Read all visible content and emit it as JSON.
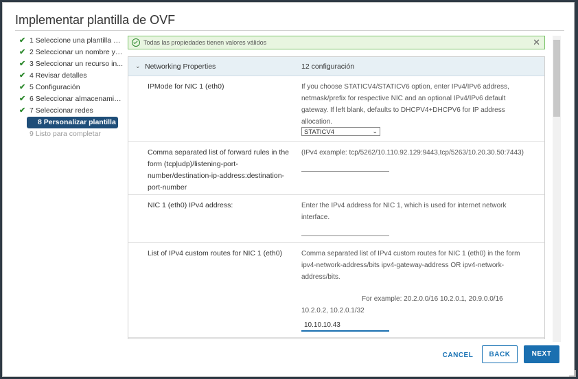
{
  "dialog": {
    "title": "Implementar plantilla de OVF"
  },
  "steps": [
    {
      "label": "1 Seleccione una plantilla d...",
      "state": "done"
    },
    {
      "label": "2 Seleccionar un nombre y ...",
      "state": "done"
    },
    {
      "label": "3 Seleccionar un recurso in...",
      "state": "done"
    },
    {
      "label": "4 Revisar detalles",
      "state": "done"
    },
    {
      "label": "5 Configuración",
      "state": "done"
    },
    {
      "label": "6 Seleccionar almacenamie...",
      "state": "done"
    },
    {
      "label": "7 Seleccionar redes",
      "state": "done"
    },
    {
      "label": "8 Personalizar plantilla",
      "state": "active"
    },
    {
      "label": "9 Listo para completar",
      "state": "disabled"
    }
  ],
  "banner": {
    "message": "Todas las propiedades tienen valores válidos",
    "close_symbol": "✕"
  },
  "group": {
    "caret": "⌄",
    "name": "Networking Properties",
    "value": "12 configuración"
  },
  "rows": {
    "ipmode": {
      "label": "IPMode for NIC 1 (eth0)",
      "description": "If you choose STATICV4/STATICV6 option, enter IPv4/IPv6 address, netmask/prefix for respective NIC and an optional IPv4/IPv6 default gateway. If left blank, defaults to DHCPV4+DHCPV6 for IP address allocation.",
      "selected": "STATICV4",
      "arrow": "⌄"
    },
    "forward": {
      "label": "Comma separated list of forward rules in the form (tcp|udp)/listening-port-number/destination-ip-address:destination-port-number",
      "description": "(IPv4 example: tcp/5262/10.110.92.129:9443,tcp/5263/10.20.30.50:7443)",
      "value": ""
    },
    "ipv4addr": {
      "label": "NIC 1 (eth0) IPv4 address:",
      "description": "Enter the IPv4 address for NIC 1, which is used for internet network interface.",
      "value": ""
    },
    "routes": {
      "label": "List of IPv4 custom routes for NIC 1 (eth0)",
      "description": "Comma separated list of IPv4 custom routes for NIC 1 (eth0) in the form ipv4-network-address/bits ipv4-gateway-address OR ipv4-network-address/bits.",
      "example": "For example: 20.2.0.0/16 10.2.0.1, 20.9.0.0/16 10.2.0.2, 10.2.0.1/32",
      "value": "10.10.10.43"
    }
  },
  "footer": {
    "cancel": "CANCEL",
    "back": "BACK",
    "next": "NEXT"
  },
  "colors": {
    "accent": "#1a6fb0",
    "active_step": "#1f4e79",
    "success": "#2e8a2e"
  }
}
